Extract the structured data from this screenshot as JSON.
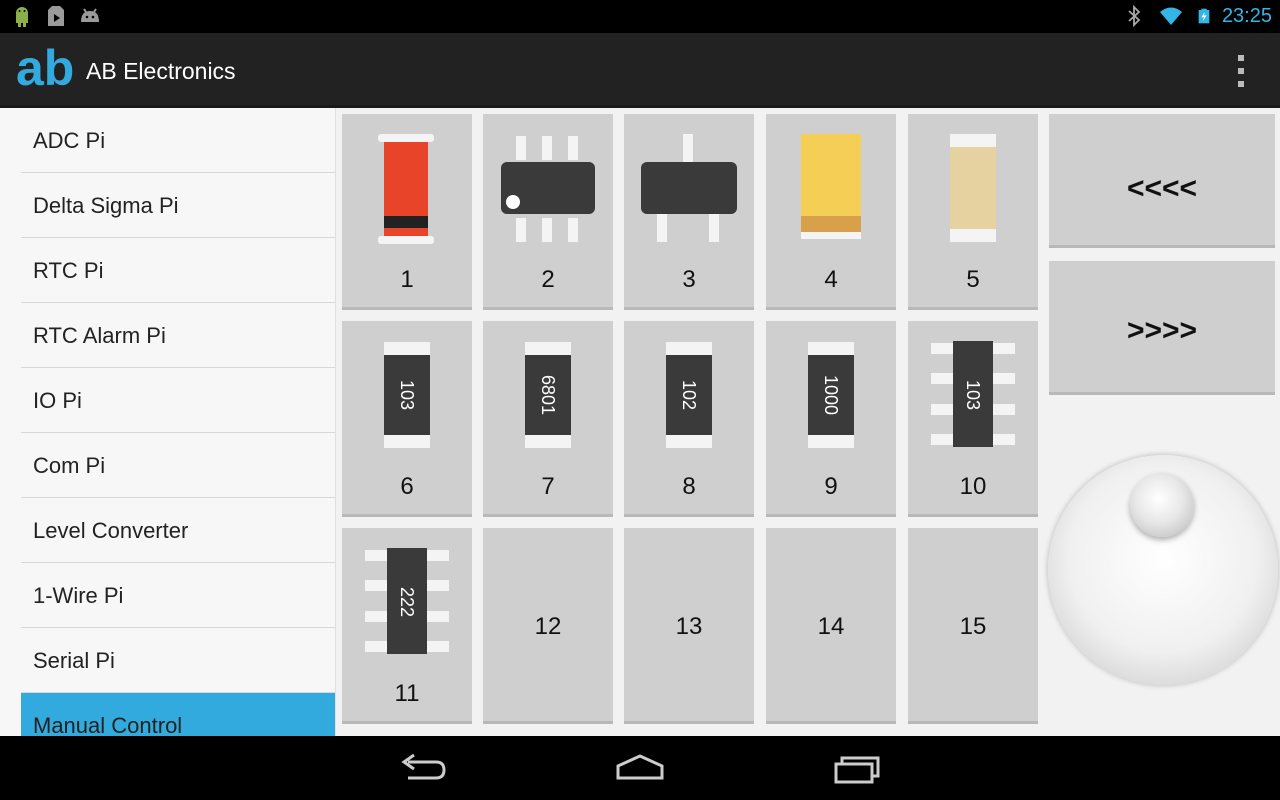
{
  "status_bar": {
    "clock": "23:25",
    "left_icons": [
      "android-icon",
      "play-store-icon",
      "android-debug-icon"
    ],
    "right_icons": [
      "bluetooth-icon",
      "wifi-icon",
      "battery-charging-icon"
    ],
    "accent_color": "#33b5e5"
  },
  "action_bar": {
    "logo_text": "ab",
    "title": "AB Electronics",
    "overflow_icon": "overflow-menu-icon"
  },
  "sidebar": {
    "items": [
      {
        "label": "ADC Pi"
      },
      {
        "label": "Delta Sigma Pi"
      },
      {
        "label": "RTC Pi"
      },
      {
        "label": "RTC Alarm Pi"
      },
      {
        "label": "IO Pi"
      },
      {
        "label": "Com Pi"
      },
      {
        "label": "Level Converter"
      },
      {
        "label": "1-Wire Pi"
      },
      {
        "label": "Serial Pi"
      },
      {
        "label": "Manual Control"
      }
    ],
    "selected": "Manual Control",
    "selected_color": "#33aadd"
  },
  "grid": {
    "tiles": [
      {
        "number": "1",
        "component": "diode-icon"
      },
      {
        "number": "2",
        "component": "ic-8pin-icon"
      },
      {
        "number": "3",
        "component": "sot23-transistor-icon"
      },
      {
        "number": "4",
        "component": "tantalum-capacitor-icon"
      },
      {
        "number": "5",
        "component": "ceramic-capacitor-icon"
      },
      {
        "number": "6",
        "component": "smd-resistor-icon",
        "marking": "103"
      },
      {
        "number": "7",
        "component": "smd-resistor-icon",
        "marking": "6801"
      },
      {
        "number": "8",
        "component": "smd-resistor-icon",
        "marking": "102"
      },
      {
        "number": "9",
        "component": "smd-resistor-icon",
        "marking": "1000"
      },
      {
        "number": "10",
        "component": "resistor-network-icon",
        "marking": "103"
      },
      {
        "number": "11",
        "component": "resistor-network-icon",
        "marking": "222"
      },
      {
        "number": "12"
      },
      {
        "number": "13"
      },
      {
        "number": "14"
      },
      {
        "number": "15"
      }
    ]
  },
  "controls": {
    "prev_label": "<<<<",
    "next_label": ">>>>",
    "joystick": "joystick-control"
  },
  "nav_bar": {
    "buttons": [
      "back-icon",
      "home-icon",
      "recent-apps-icon"
    ]
  }
}
